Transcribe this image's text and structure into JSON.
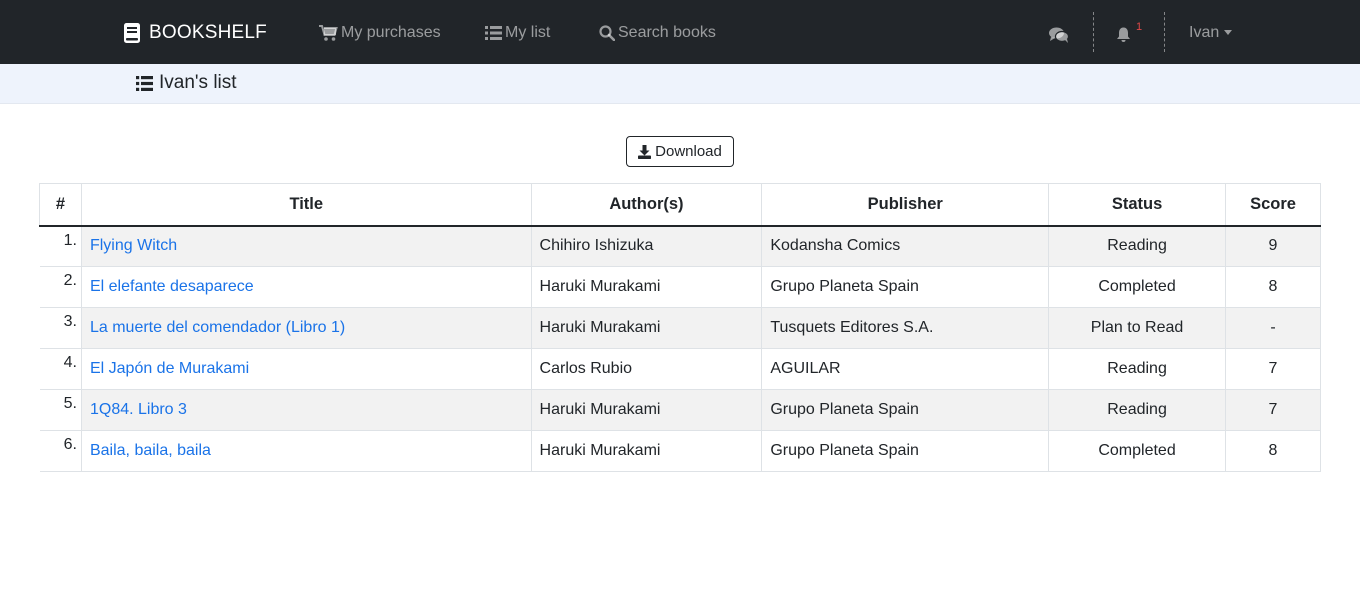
{
  "navbar": {
    "brand": "BOOKSHELF",
    "links": {
      "purchases": "My purchases",
      "mylist": "My list",
      "search": "Search books"
    },
    "notification_count": "1",
    "user": "Ivan"
  },
  "subheader": {
    "title": "Ivan's list"
  },
  "download_label": "Download",
  "table": {
    "headers": {
      "num": "#",
      "title": "Title",
      "author": "Author(s)",
      "publisher": "Publisher",
      "status": "Status",
      "score": "Score"
    },
    "rows": [
      {
        "num": "1.",
        "title": "Flying Witch",
        "author": "Chihiro Ishizuka",
        "publisher": "Kodansha Comics",
        "status": "Reading",
        "score": "9"
      },
      {
        "num": "2.",
        "title": "El elefante desaparece",
        "author": "Haruki Murakami",
        "publisher": "Grupo Planeta Spain",
        "status": "Completed",
        "score": "8"
      },
      {
        "num": "3.",
        "title": "La muerte del comendador (Libro 1)",
        "author": "Haruki Murakami",
        "publisher": "Tusquets Editores S.A.",
        "status": "Plan to Read",
        "score": "-"
      },
      {
        "num": "4.",
        "title": "El Japón de Murakami",
        "author": "Carlos Rubio",
        "publisher": "AGUILAR",
        "status": "Reading",
        "score": "7"
      },
      {
        "num": "5.",
        "title": "1Q84. Libro 3",
        "author": "Haruki Murakami",
        "publisher": "Grupo Planeta Spain",
        "status": "Reading",
        "score": "7"
      },
      {
        "num": "6.",
        "title": "Baila, baila, baila",
        "author": "Haruki Murakami",
        "publisher": "Grupo Planeta Spain",
        "status": "Completed",
        "score": "8"
      }
    ]
  },
  "icons": {
    "brand": "book-icon",
    "purchases": "cart-icon",
    "mylist": "list-icon",
    "search": "search-icon",
    "chat": "comments-icon",
    "notifications": "bell-icon",
    "download": "download-icon"
  },
  "colors": {
    "navbar_bg": "#212529",
    "link_blue": "#1a73e8",
    "subheader_bg": "#eef3fc",
    "badge_red": "#e04848"
  }
}
